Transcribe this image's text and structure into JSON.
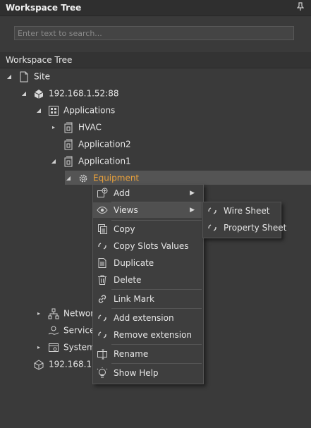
{
  "panel": {
    "title": "Workspace Tree",
    "pin_icon": "pin-icon"
  },
  "search": {
    "placeholder": "Enter text to search..."
  },
  "tree": {
    "header": "Workspace Tree",
    "nodes": [
      {
        "label": "Site",
        "icon": "page-icon",
        "expanded": true
      },
      {
        "label": "192.168.1.52:88",
        "icon": "server-icon",
        "expanded": true
      },
      {
        "label": "Applications",
        "icon": "applications-icon",
        "expanded": true
      },
      {
        "label": "HVAC",
        "icon": "app-icon",
        "expanded": false
      },
      {
        "label": "Application2",
        "icon": "app-icon"
      },
      {
        "label": "Application1",
        "icon": "app-icon",
        "expanded": true
      },
      {
        "label": "Equipment",
        "icon": "gear-icon",
        "expanded": true,
        "selected": true
      },
      {
        "label": "Networ",
        "icon": "network-icon",
        "expanded": false
      },
      {
        "label": "Service",
        "icon": "service-icon"
      },
      {
        "label": "System",
        "icon": "system-icon",
        "expanded": false
      },
      {
        "label": "192.168.1.",
        "icon": "server-icon"
      }
    ]
  },
  "context_menu": {
    "items": [
      {
        "label": "Add",
        "icon": "add-icon",
        "submenu": true
      },
      {
        "label": "Views",
        "icon": "eye-icon",
        "submenu": true,
        "highlighted": true
      },
      {
        "label": "Copy",
        "icon": "copy-icon"
      },
      {
        "label": "Copy Slots Values",
        "icon": "spinner-icon"
      },
      {
        "label": "Duplicate",
        "icon": "duplicate-icon"
      },
      {
        "label": "Delete",
        "icon": "trash-icon"
      },
      {
        "label": "Link Mark",
        "icon": "link-icon"
      },
      {
        "label": "Add extension",
        "icon": "spinner-icon"
      },
      {
        "label": "Remove extension",
        "icon": "spinner-icon"
      },
      {
        "label": "Rename",
        "icon": "rename-icon"
      },
      {
        "label": "Show Help",
        "icon": "help-bulb-icon"
      }
    ]
  },
  "views_submenu": {
    "items": [
      {
        "label": "Wire Sheet",
        "icon": "spinner-icon"
      },
      {
        "label": "Property Sheet",
        "icon": "spinner-icon"
      }
    ]
  },
  "colors": {
    "background": "#3a3a3a",
    "selected_text": "#e9a13b",
    "menu_bg": "#3e3e3e"
  }
}
